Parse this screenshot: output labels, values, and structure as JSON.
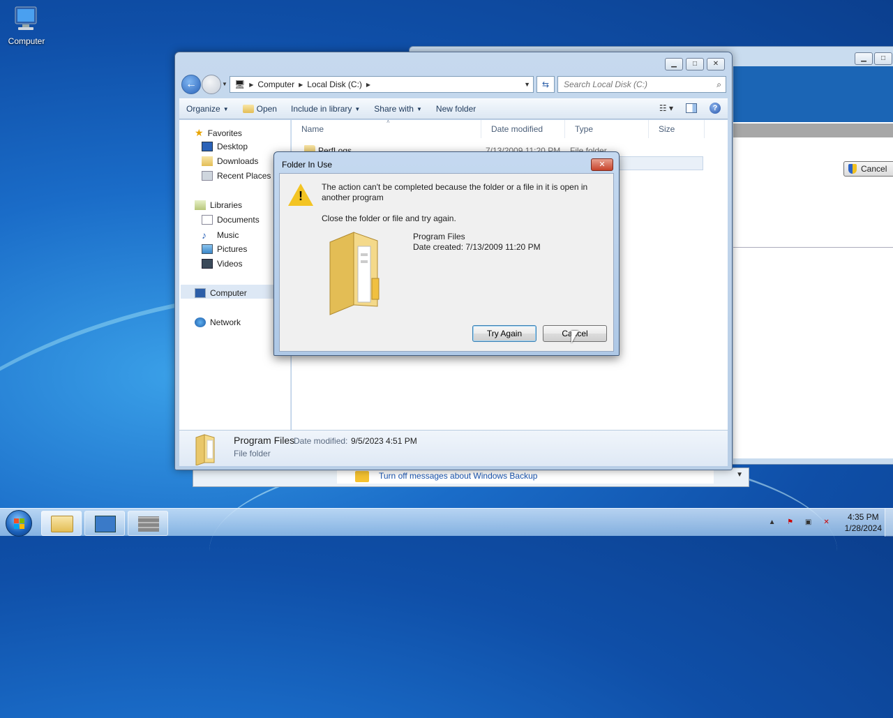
{
  "desktop": {
    "icon_label": "Computer"
  },
  "background_window": {
    "cancel_label": "Cancel"
  },
  "backup_bar": {
    "link": "Turn off messages about Windows Backup"
  },
  "explorer": {
    "address": {
      "crumbs": [
        "Computer",
        "Local Disk (C:)"
      ]
    },
    "search_placeholder": "Search Local Disk (C:)",
    "toolbar": {
      "organize": "Organize",
      "open": "Open",
      "include": "Include in library",
      "share": "Share with",
      "new_folder": "New folder"
    },
    "nav": {
      "favorites": "Favorites",
      "desktop": "Desktop",
      "downloads": "Downloads",
      "recent": "Recent Places",
      "libraries": "Libraries",
      "documents": "Documents",
      "music": "Music",
      "pictures": "Pictures",
      "videos": "Videos",
      "computer": "Computer",
      "network": "Network"
    },
    "columns": {
      "name": "Name",
      "date": "Date modified",
      "type": "Type",
      "size": "Size"
    },
    "rows": [
      {
        "name": "PerfLogs",
        "date": "7/13/2009 11:20 PM",
        "type": "File folder"
      }
    ],
    "details": {
      "name": "Program Files",
      "date_label": "Date modified:",
      "date": "9/5/2023 4:51 PM",
      "type": "File folder"
    }
  },
  "dialog": {
    "title": "Folder In Use",
    "message": "The action can't be completed because the folder or a file in it is open in another program",
    "instruction": "Close the folder or file and try again.",
    "file_name": "Program Files",
    "file_date": "Date created: 7/13/2009 11:20 PM",
    "try_again": "Try Again",
    "cancel": "Cancel"
  },
  "taskbar": {
    "time": "4:35 PM",
    "date": "1/28/2024"
  }
}
